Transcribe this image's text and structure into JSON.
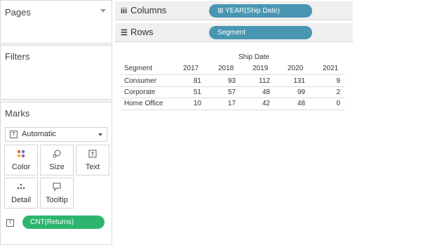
{
  "left": {
    "pages": {
      "title": "Pages"
    },
    "filters": {
      "title": "Filters"
    },
    "marks": {
      "title": "Marks",
      "mark_type": "Automatic",
      "buttons": [
        "Color",
        "Size",
        "Text",
        "Detail",
        "Tooltip"
      ],
      "text_pill": "CNT(Returns)"
    }
  },
  "shelves": {
    "columns": {
      "label": "Columns",
      "pill": "⊞ YEAR(Ship Date)"
    },
    "rows": {
      "label": "Rows",
      "pill": "Segment"
    }
  },
  "table": {
    "header": "Ship Date",
    "row_header": "Segment",
    "years": [
      "2017",
      "2018",
      "2019",
      "2020",
      "2021"
    ],
    "rows": [
      {
        "segment": "Consumer",
        "values": [
          "81",
          "93",
          "112",
          "131",
          "9"
        ]
      },
      {
        "segment": "Corporate",
        "values": [
          "51",
          "57",
          "48",
          "99",
          "2"
        ]
      },
      {
        "segment": "Home Office",
        "values": [
          "10",
          "17",
          "42",
          "48",
          "0"
        ]
      }
    ]
  },
  "colors": {
    "pill_blue": "#4996b2",
    "pill_green": "#2db56e"
  }
}
